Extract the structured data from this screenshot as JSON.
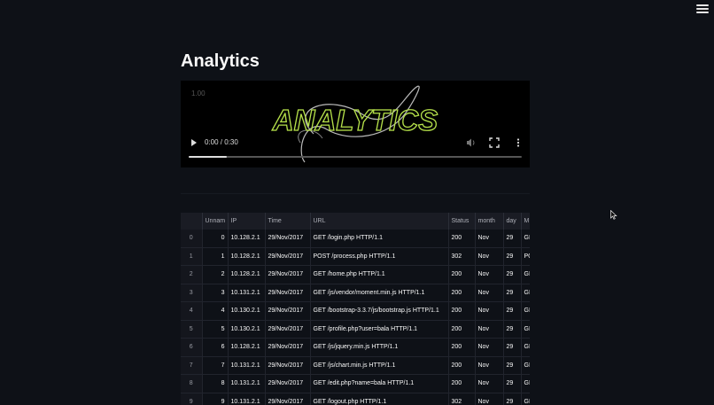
{
  "header": {
    "menu_icon": "hamburger-menu-icon"
  },
  "page": {
    "title": "Analytics"
  },
  "video": {
    "speed_label": "1.00",
    "overlay_text": "ANALYTICS",
    "time_display": "0:00 / 0:30",
    "progress": 0.115,
    "icons": {
      "play": "play-icon",
      "volume": "volume-icon",
      "fullscreen": "fullscreen-icon",
      "more": "more-vertical-icon"
    },
    "colors": {
      "overlay_text": "#b5e04a"
    }
  },
  "table": {
    "columns": [
      "",
      "Unnam",
      "IP",
      "Time",
      "URL",
      "Status",
      "month",
      "day",
      "M"
    ],
    "rows": [
      [
        "0",
        "0",
        "10.128.2.1",
        "29/Nov/2017",
        "GET /login.php HTTP/1.1",
        "200",
        "Nov",
        "29",
        "GI"
      ],
      [
        "1",
        "1",
        "10.128.2.1",
        "29/Nov/2017",
        "POST /process.php HTTP/1.1",
        "302",
        "Nov",
        "29",
        "PC"
      ],
      [
        "2",
        "2",
        "10.128.2.1",
        "29/Nov/2017",
        "GET /home.php HTTP/1.1",
        "200",
        "Nov",
        "29",
        "GI"
      ],
      [
        "3",
        "3",
        "10.131.2.1",
        "29/Nov/2017",
        "GET /js/vendor/moment.min.js HTTP/1.1",
        "200",
        "Nov",
        "29",
        "GI"
      ],
      [
        "4",
        "4",
        "10.130.2.1",
        "29/Nov/2017",
        "GET /bootstrap-3.3.7/js/bootstrap.js HTTP/1.1",
        "200",
        "Nov",
        "29",
        "GI"
      ],
      [
        "5",
        "5",
        "10.130.2.1",
        "29/Nov/2017",
        "GET /profile.php?user=bala HTTP/1.1",
        "200",
        "Nov",
        "29",
        "GI"
      ],
      [
        "6",
        "6",
        "10.128.2.1",
        "29/Nov/2017",
        "GET /js/jquery.min.js HTTP/1.1",
        "200",
        "Nov",
        "29",
        "GI"
      ],
      [
        "7",
        "7",
        "10.131.2.1",
        "29/Nov/2017",
        "GET /js/chart.min.js HTTP/1.1",
        "200",
        "Nov",
        "29",
        "GI"
      ],
      [
        "8",
        "8",
        "10.131.2.1",
        "29/Nov/2017",
        "GET /edit.php?name=bala HTTP/1.1",
        "200",
        "Nov",
        "29",
        "GI"
      ],
      [
        "9",
        "9",
        "10.131.2.1",
        "29/Nov/2017",
        "GET /logout.php HTTP/1.1",
        "302",
        "Nov",
        "29",
        "GI"
      ]
    ]
  }
}
